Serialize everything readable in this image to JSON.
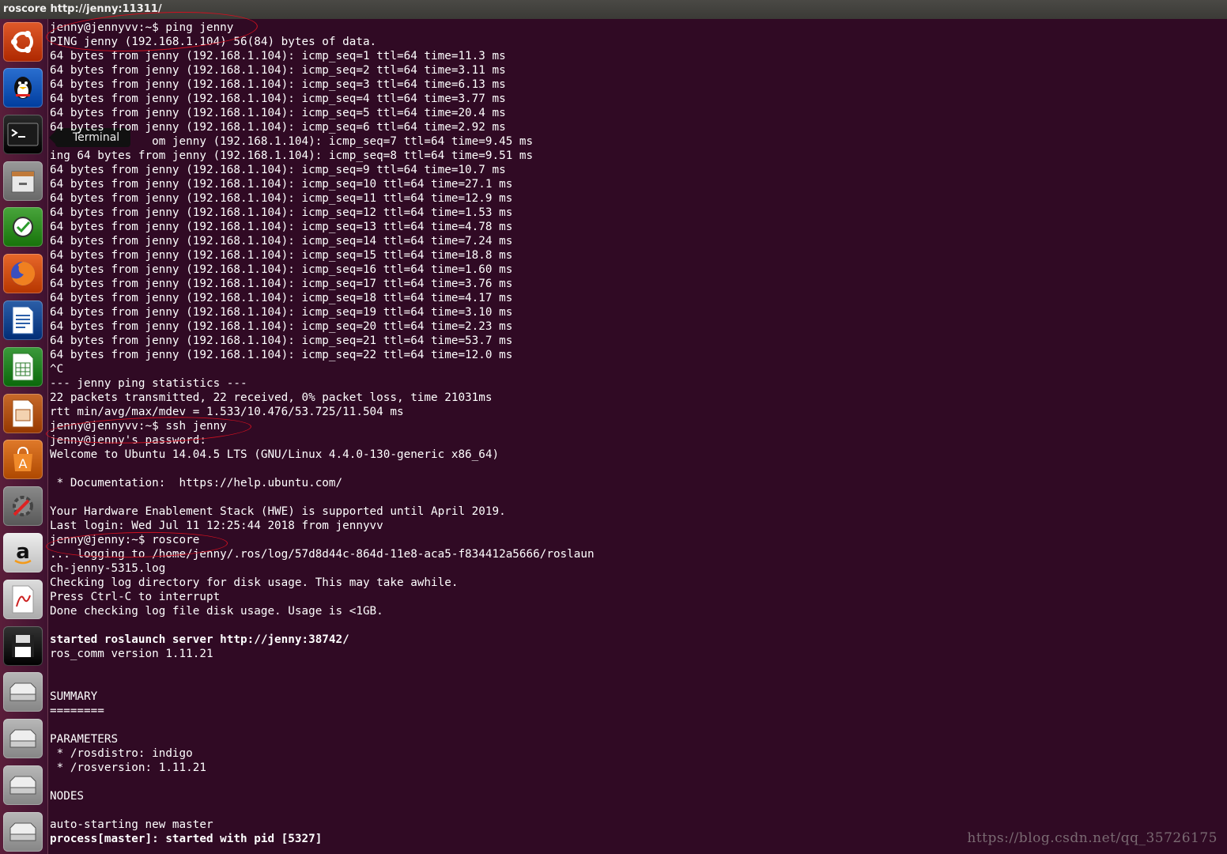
{
  "window": {
    "title": "roscore http://jenny:11311/"
  },
  "launcher": {
    "tooltip": "Terminal",
    "items": [
      {
        "name": "ubuntu-dash-icon",
        "color": "#e05a2a"
      },
      {
        "name": "qq-penguin-icon",
        "color": "#2a6fd0"
      },
      {
        "name": "terminal-icon",
        "color": "#2b2b2b"
      },
      {
        "name": "file-cabinet-icon",
        "color": "#9a9a9a"
      },
      {
        "name": "system-tool-icon",
        "color": "#49a53c"
      },
      {
        "name": "firefox-icon",
        "color": "#e8682a"
      },
      {
        "name": "libreoffice-writer-icon",
        "color": "#2c5fa8"
      },
      {
        "name": "libreoffice-calc-icon",
        "color": "#3c9a3c"
      },
      {
        "name": "libreoffice-impress-icon",
        "color": "#c86a2a"
      },
      {
        "name": "software-center-icon",
        "color": "#e07a2a"
      },
      {
        "name": "system-settings-icon",
        "color": "#8a8a8a"
      },
      {
        "name": "amazon-icon",
        "color": "#eeeeee"
      },
      {
        "name": "document-viewer-icon",
        "color": "#dddddd"
      },
      {
        "name": "save-disk-icon",
        "color": "#333333"
      },
      {
        "name": "drive-icon-1",
        "color": "#b8b8b8"
      },
      {
        "name": "drive-icon-2",
        "color": "#b8b8b8"
      },
      {
        "name": "drive-icon-3",
        "color": "#b8b8b8"
      },
      {
        "name": "drive-icon-4",
        "color": "#b8b8b8"
      }
    ]
  },
  "terminal": {
    "lines": [
      {
        "text": "jenny@jennyvv:~$ ping jenny"
      },
      {
        "text": "PING jenny (192.168.1.104) 56(84) bytes of data."
      },
      {
        "text": "64 bytes from jenny (192.168.1.104): icmp_seq=1 ttl=64 time=11.3 ms"
      },
      {
        "text": "64 bytes from jenny (192.168.1.104): icmp_seq=2 ttl=64 time=3.11 ms"
      },
      {
        "text": "64 bytes from jenny (192.168.1.104): icmp_seq=3 ttl=64 time=6.13 ms"
      },
      {
        "text": "64 bytes from jenny (192.168.1.104): icmp_seq=4 ttl=64 time=3.77 ms"
      },
      {
        "text": "64 bytes from jenny (192.168.1.104): icmp_seq=5 ttl=64 time=20.4 ms"
      },
      {
        "text": "64 bytes from jenny (192.168.1.104): icmp_seq=6 ttl=64 time=2.92 ms"
      },
      {
        "text": "               om jenny (192.168.1.104): icmp_seq=7 ttl=64 time=9.45 ms"
      },
      {
        "text": "ing 64 bytes from jenny (192.168.1.104): icmp_seq=8 ttl=64 time=9.51 ms"
      },
      {
        "text": "64 bytes from jenny (192.168.1.104): icmp_seq=9 ttl=64 time=10.7 ms"
      },
      {
        "text": "64 bytes from jenny (192.168.1.104): icmp_seq=10 ttl=64 time=27.1 ms"
      },
      {
        "text": "64 bytes from jenny (192.168.1.104): icmp_seq=11 ttl=64 time=12.9 ms"
      },
      {
        "text": "64 bytes from jenny (192.168.1.104): icmp_seq=12 ttl=64 time=1.53 ms"
      },
      {
        "text": "64 bytes from jenny (192.168.1.104): icmp_seq=13 ttl=64 time=4.78 ms"
      },
      {
        "text": "64 bytes from jenny (192.168.1.104): icmp_seq=14 ttl=64 time=7.24 ms"
      },
      {
        "text": "64 bytes from jenny (192.168.1.104): icmp_seq=15 ttl=64 time=18.8 ms"
      },
      {
        "text": "64 bytes from jenny (192.168.1.104): icmp_seq=16 ttl=64 time=1.60 ms"
      },
      {
        "text": "64 bytes from jenny (192.168.1.104): icmp_seq=17 ttl=64 time=3.76 ms"
      },
      {
        "text": "64 bytes from jenny (192.168.1.104): icmp_seq=18 ttl=64 time=4.17 ms"
      },
      {
        "text": "64 bytes from jenny (192.168.1.104): icmp_seq=19 ttl=64 time=3.10 ms"
      },
      {
        "text": "64 bytes from jenny (192.168.1.104): icmp_seq=20 ttl=64 time=2.23 ms"
      },
      {
        "text": "64 bytes from jenny (192.168.1.104): icmp_seq=21 ttl=64 time=53.7 ms"
      },
      {
        "text": "64 bytes from jenny (192.168.1.104): icmp_seq=22 ttl=64 time=12.0 ms"
      },
      {
        "text": "^C"
      },
      {
        "text": "--- jenny ping statistics ---"
      },
      {
        "text": "22 packets transmitted, 22 received, 0% packet loss, time 21031ms"
      },
      {
        "text": "rtt min/avg/max/mdev = 1.533/10.476/53.725/11.504 ms"
      },
      {
        "text": "jenny@jennyvv:~$ ssh jenny"
      },
      {
        "text": "jenny@jenny's password:"
      },
      {
        "text": "Welcome to Ubuntu 14.04.5 LTS (GNU/Linux 4.4.0-130-generic x86_64)"
      },
      {
        "text": ""
      },
      {
        "text": " * Documentation:  https://help.ubuntu.com/"
      },
      {
        "text": ""
      },
      {
        "text": "Your Hardware Enablement Stack (HWE) is supported until April 2019."
      },
      {
        "text": "Last login: Wed Jul 11 12:25:44 2018 from jennyvv"
      },
      {
        "text": "jenny@jenny:~$ roscore"
      },
      {
        "text": "... logging to /home/jenny/.ros/log/57d8d44c-864d-11e8-aca5-f834412a5666/roslaun"
      },
      {
        "text": "ch-jenny-5315.log"
      },
      {
        "text": "Checking log directory for disk usage. This may take awhile."
      },
      {
        "text": "Press Ctrl-C to interrupt"
      },
      {
        "text": "Done checking log file disk usage. Usage is <1GB."
      },
      {
        "text": ""
      },
      {
        "text": "started roslaunch server http://jenny:38742/",
        "bold": true
      },
      {
        "text": "ros_comm version 1.11.21"
      },
      {
        "text": ""
      },
      {
        "text": ""
      },
      {
        "text": "SUMMARY"
      },
      {
        "text": "========"
      },
      {
        "text": ""
      },
      {
        "text": "PARAMETERS"
      },
      {
        "text": " * /rosdistro: indigo"
      },
      {
        "text": " * /rosversion: 1.11.21"
      },
      {
        "text": ""
      },
      {
        "text": "NODES"
      },
      {
        "text": ""
      },
      {
        "text": "auto-starting new master"
      },
      {
        "text": "process[master]: started with pid [5327]",
        "bold": true
      }
    ]
  },
  "watermark": "https://blog.csdn.net/qq_35726175"
}
